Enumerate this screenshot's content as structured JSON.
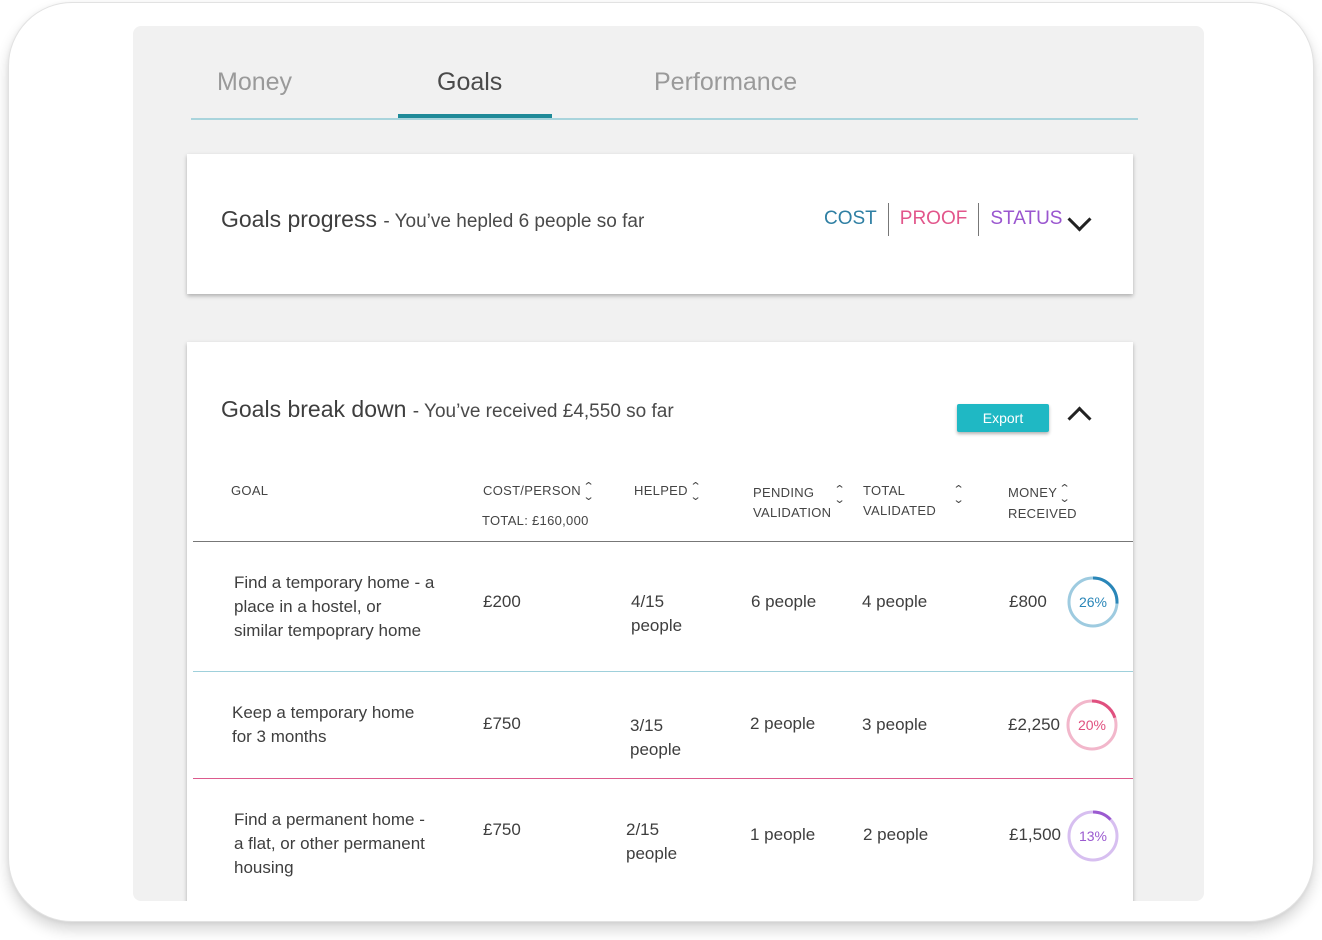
{
  "tabs": [
    {
      "label": "Money",
      "active": false
    },
    {
      "label": "Goals",
      "active": true
    },
    {
      "label": "Performance",
      "active": false
    }
  ],
  "progress_card": {
    "title": "Goals progress",
    "subtitle": "- You’ve hepled 6 people so far",
    "legend": {
      "cost": "COST",
      "proof": "PROOF",
      "status": "STATUS"
    }
  },
  "breakdown_card": {
    "title": "Goals break down",
    "subtitle": "- You’ve received £4,550 so far",
    "export_label": "Export",
    "columns": {
      "goal": "GOAL",
      "cost": "COST/PERSON",
      "cost_total": "TOTAL: £160,000",
      "helped": "HELPED",
      "pending_1": "PENDING",
      "pending_2": "VALIDATION",
      "validated_1": "TOTAL",
      "validated_2": "VALIDATED",
      "money_1": "MONEY",
      "money_2": "RECEIVED"
    },
    "rows": [
      {
        "goal_lines": [
          "Find a temporary home - a",
          "place in a hostel, or",
          "similar tempoprary home"
        ],
        "cost": "£200",
        "helped_lines": [
          "4/15",
          "people"
        ],
        "pending": "6 people",
        "validated": "4 people",
        "money": "£800",
        "percent_label": "26%",
        "percent": 0.26,
        "color": "#2a86b8",
        "track": "#9ecbe0",
        "line_color": "#9fd0db"
      },
      {
        "goal_lines": [
          "Keep a temporary home",
          "for 3 months"
        ],
        "cost": "£750",
        "helped_lines": [
          "3/15",
          "people"
        ],
        "pending": "2 people",
        "validated": "3 people",
        "money": "£2,250",
        "percent_label": "20%",
        "percent": 0.2,
        "color": "#e0507f",
        "track": "#f2b7cb",
        "line_color": "#dc5a8d"
      },
      {
        "goal_lines": [
          "Find a permanent home -",
          "a flat, or other permanent",
          "housing"
        ],
        "cost": "£750",
        "helped_lines": [
          "2/15",
          "people"
        ],
        "pending": "1 people",
        "validated": "2 people",
        "money": "£1,500",
        "percent_label": "13%",
        "percent": 0.13,
        "color": "#9b5ad0",
        "track": "#d7bff0",
        "line_color": ""
      }
    ]
  }
}
